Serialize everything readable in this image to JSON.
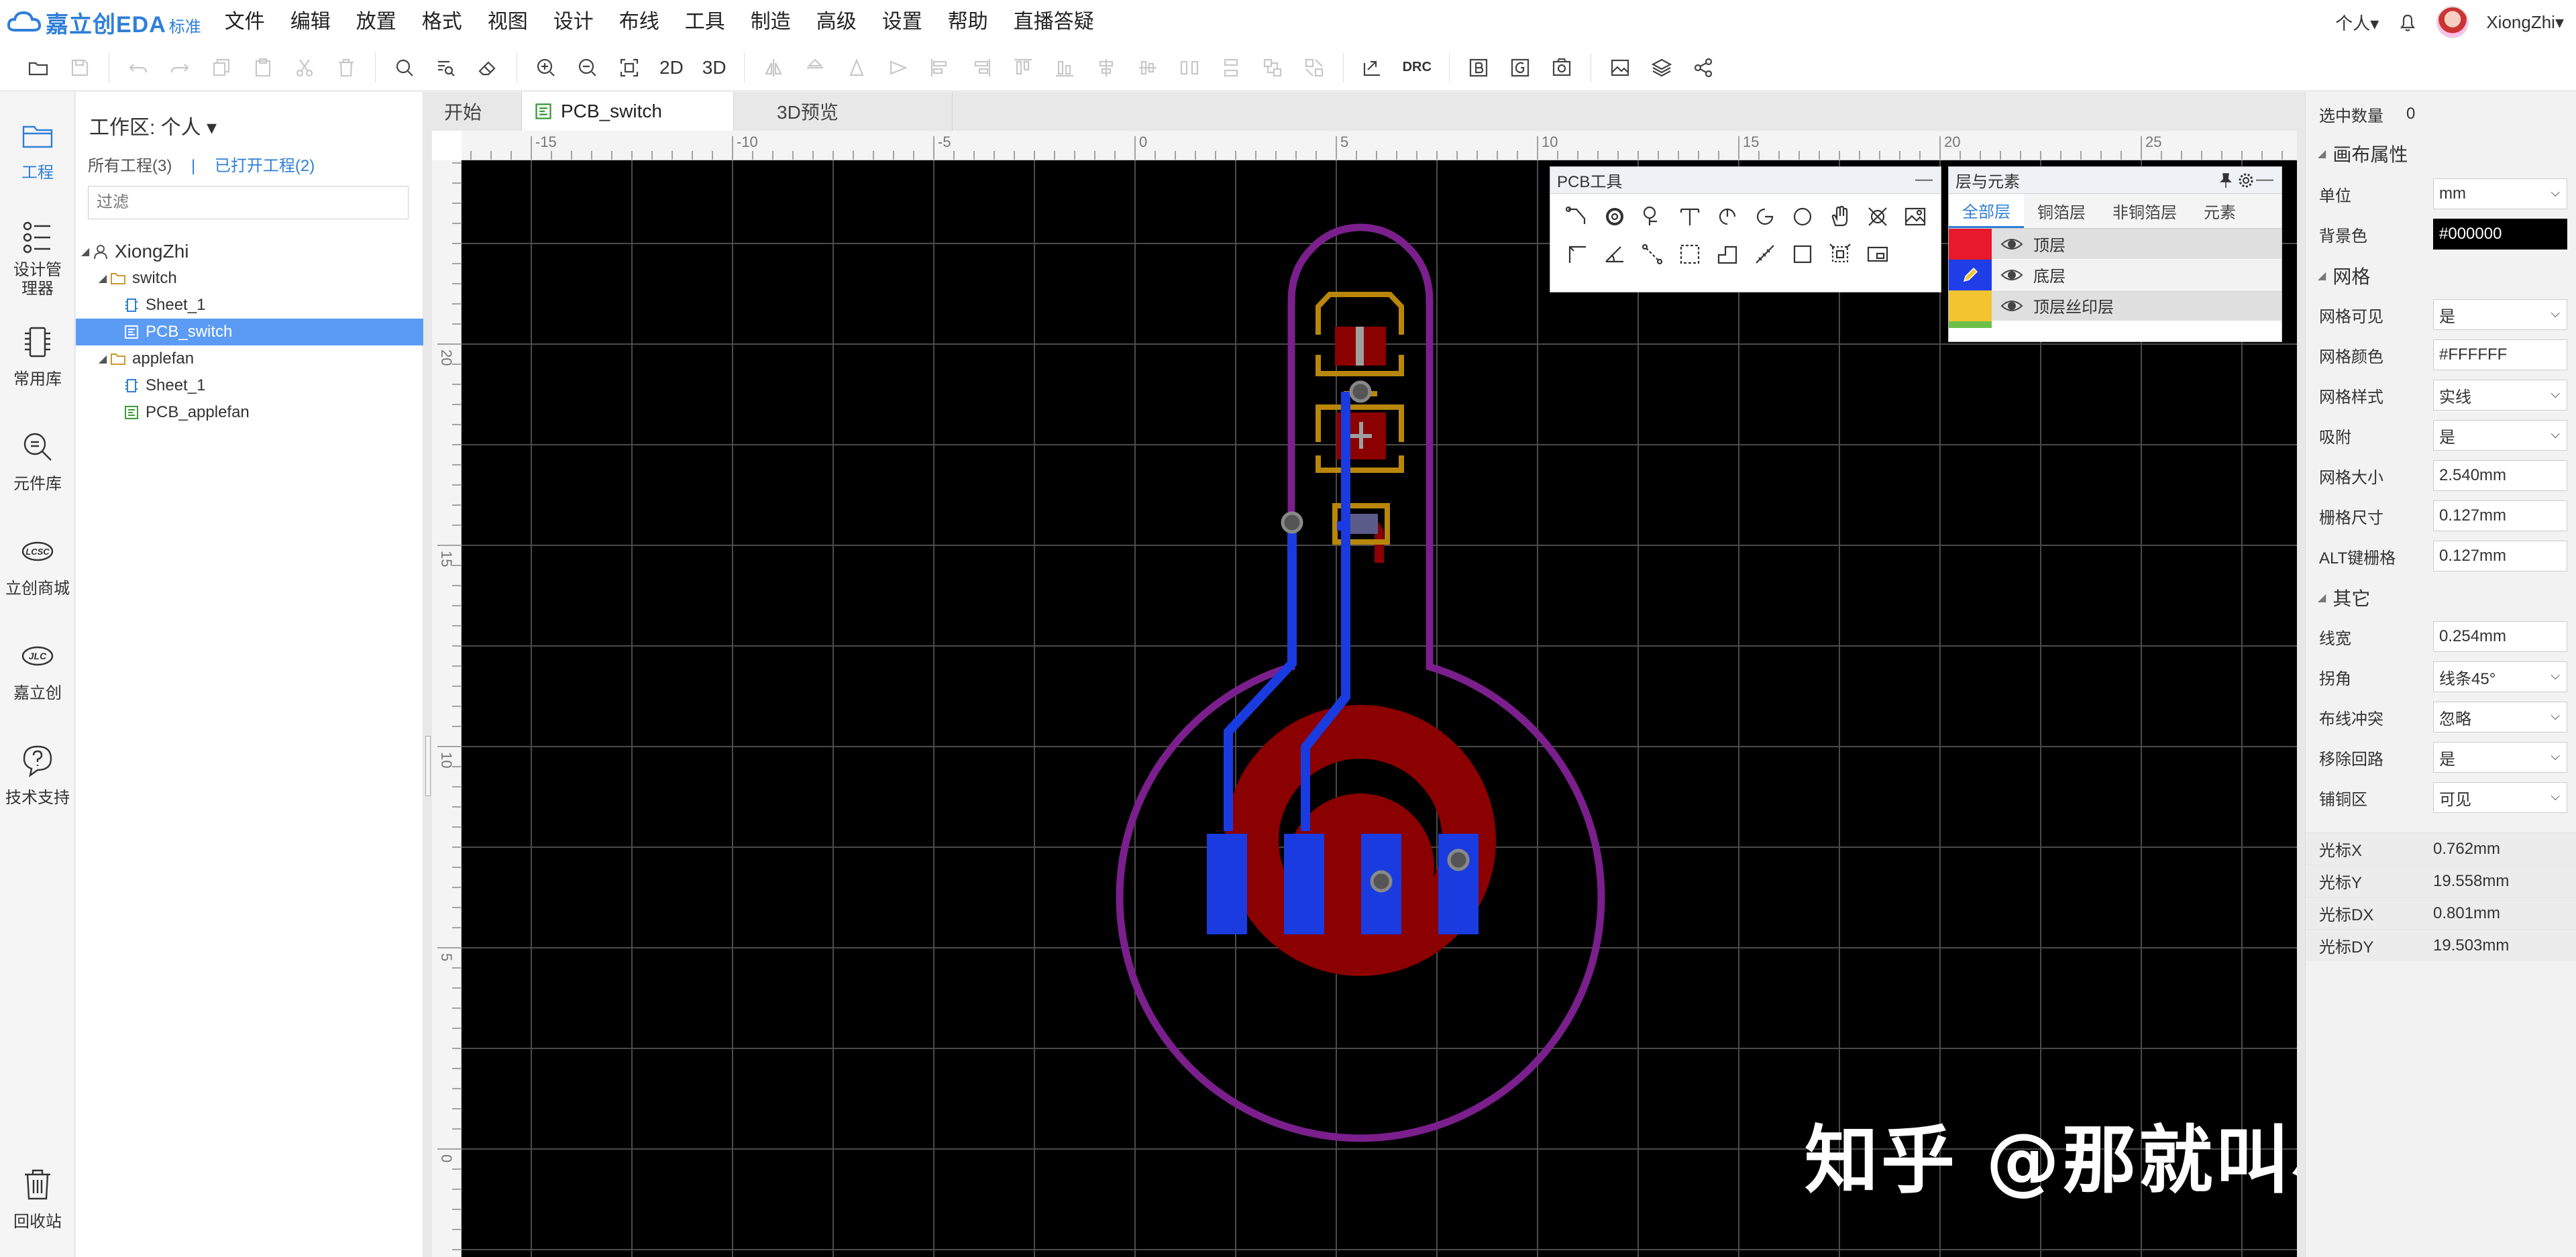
{
  "app": {
    "brand": "嘉立创EDA",
    "edition": "标准"
  },
  "menu": [
    "文件",
    "编辑",
    "放置",
    "格式",
    "视图",
    "设计",
    "布线",
    "工具",
    "制造",
    "高级",
    "设置",
    "帮助",
    "直播答疑"
  ],
  "user": {
    "scope": "个人▾",
    "name": "XiongZhi▾"
  },
  "toolbar": {
    "view_2d": "2D",
    "view_3d": "3D",
    "drc": "DRC"
  },
  "leftrail": [
    {
      "label": "工程",
      "icon": "folder-icon"
    },
    {
      "label": "设计管理器",
      "icon": "design-manager-icon"
    },
    {
      "label": "常用库",
      "icon": "common-library-icon"
    },
    {
      "label": "元件库",
      "icon": "component-search-icon"
    },
    {
      "label": "立创商城",
      "icon": "lcsc-icon"
    },
    {
      "label": "嘉立创",
      "icon": "jlc-icon"
    },
    {
      "label": "技术支持",
      "icon": "help-icon"
    },
    {
      "label": "回收站",
      "icon": "trash-icon"
    }
  ],
  "project": {
    "workspace": "工作区: 个人 ▾",
    "all_projects": "所有工程(3)",
    "divider": "|",
    "open_projects": "已打开工程(2)",
    "filter_placeholder": "过滤",
    "tree": [
      {
        "label": "XiongZhi",
        "level": 0,
        "type": "user"
      },
      {
        "label": "switch",
        "level": 1,
        "type": "folder"
      },
      {
        "label": "Sheet_1",
        "level": 2,
        "type": "sheet"
      },
      {
        "label": "PCB_switch",
        "level": 2,
        "type": "pcb",
        "selected": true
      },
      {
        "label": "applefan",
        "level": 1,
        "type": "folder"
      },
      {
        "label": "Sheet_1",
        "level": 2,
        "type": "sheet"
      },
      {
        "label": "PCB_applefan",
        "level": 2,
        "type": "pcb"
      }
    ]
  },
  "tabs": [
    {
      "label": "开始"
    },
    {
      "label": "PCB_switch",
      "active": true
    },
    {
      "label": "3D预览"
    }
  ],
  "ruler": {
    "h_ticks": [
      "-15",
      "-10",
      "-5",
      "0",
      "5",
      "10",
      "15",
      "20",
      "25"
    ],
    "v_ticks": [
      "20",
      "15",
      "10",
      "5",
      "0"
    ]
  },
  "pcb_tools": {
    "title": "PCB工具",
    "min": "—"
  },
  "layers_panel": {
    "title": "层与元素",
    "tabs": [
      "全部层",
      "铜箔层",
      "非铜箔层",
      "元素"
    ],
    "rows": [
      {
        "name": "顶层",
        "color": "#e8192c"
      },
      {
        "name": "底层",
        "color": "#1f3ee8"
      },
      {
        "name": "顶层丝印层",
        "color": "#f4c430"
      }
    ]
  },
  "props": {
    "selected_count_label": "选中数量",
    "selected_count": "0",
    "canvas_section": "画布属性",
    "unit_label": "单位",
    "unit": "mm",
    "bg_label": "背景色",
    "bg": "#000000",
    "grid_section": "网格",
    "grid_visible_label": "网格可见",
    "grid_visible": "是",
    "grid_color_label": "网格颜色",
    "grid_color": "#FFFFFF",
    "grid_style_label": "网格样式",
    "grid_style": "实线",
    "snap_label": "吸附",
    "snap": "是",
    "grid_size_label": "网格大小",
    "grid_size": "2.540mm",
    "snap_size_label": "栅格尺寸",
    "snap_size": "0.127mm",
    "alt_snap_label": "ALT键栅格",
    "alt_snap": "0.127mm",
    "other_section": "其它",
    "line_width_label": "线宽",
    "line_width": "0.254mm",
    "corner_label": "拐角",
    "corner": "线条45°",
    "conflict_label": "布线冲突",
    "conflict": "忽略",
    "remove_loop_label": "移除回路",
    "remove_loop": "是",
    "pour_label": "铺铜区",
    "pour": "可见",
    "cursor_x_label": "光标X",
    "cursor_x": "0.762mm",
    "cursor_y_label": "光标Y",
    "cursor_y": "19.558mm",
    "cursor_dx_label": "光标DX",
    "cursor_dx": "0.801mm",
    "cursor_dy_label": "光标DY",
    "cursor_dy": "19.503mm"
  },
  "watermark": "知乎 @那就叫小熊吧",
  "colors": {
    "board_bg": "#000000",
    "outline": "#7a1f8c",
    "top_copper": "#8b0000",
    "bottom_copper": "#1a3be0",
    "silk": "#b8860b",
    "accent": "#2f7fd8"
  }
}
